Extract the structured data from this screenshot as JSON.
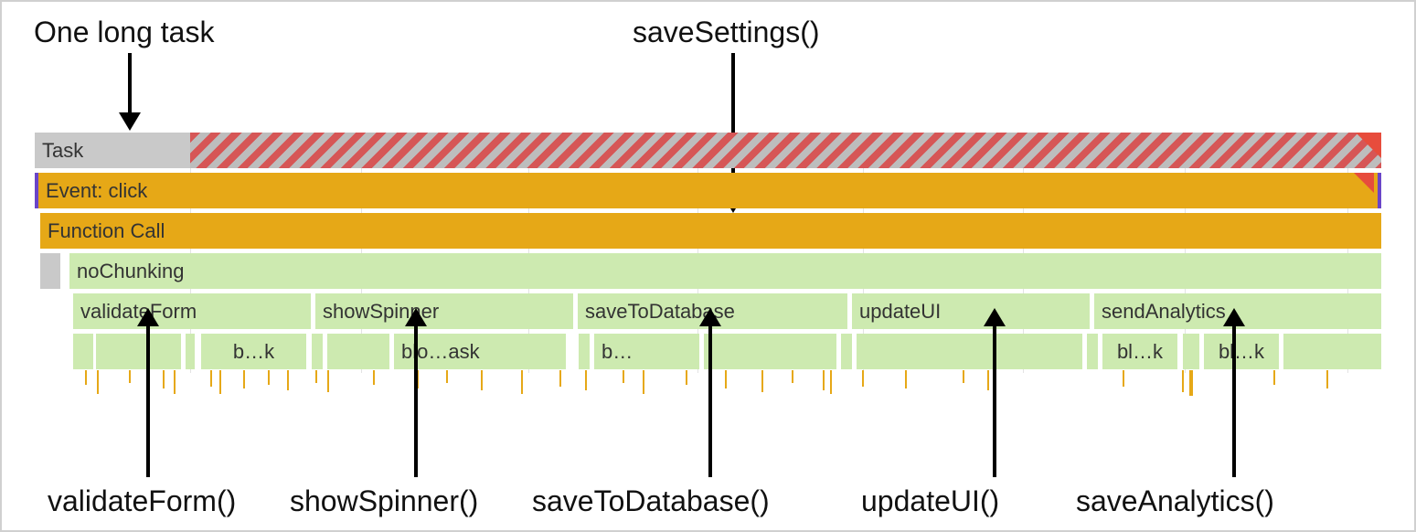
{
  "annotations": {
    "top_left": "One long task",
    "top_center": "saveSettings()",
    "bottom": {
      "validateForm": "validateForm()",
      "showSpinner": "showSpinner()",
      "saveToDatabase": "saveToDatabase()",
      "updateUI": "updateUI()",
      "saveAnalytics": "saveAnalytics()"
    }
  },
  "rows": {
    "task": {
      "label": "Task"
    },
    "event": {
      "label": "Event: click"
    },
    "funccall": {
      "label": "Function Call"
    },
    "noChunking": {
      "label": "noChunking"
    },
    "children": {
      "validateForm": "validateForm",
      "showSpinner": "showSpinner",
      "saveToDatabase": "saveToDatabase",
      "updateUI": "updateUI",
      "sendAnalytics": "sendAnalytics"
    },
    "chips": {
      "bk1": "b…k",
      "bloask": "blo…ask",
      "b2": "b…",
      "blk3": "bl…k",
      "blk4": "bl…k"
    }
  }
}
